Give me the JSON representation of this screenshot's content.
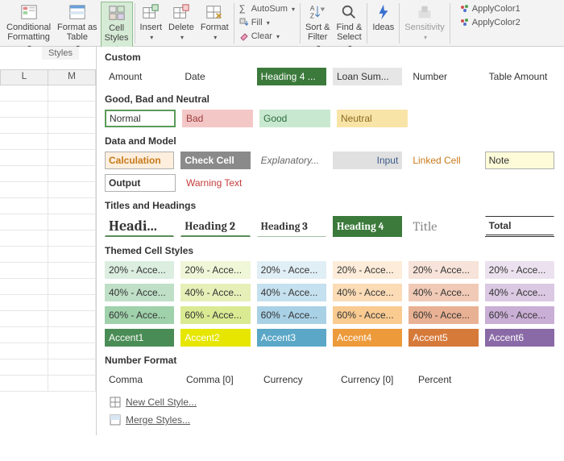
{
  "ribbon": {
    "cond_fmt": "Conditional\nFormatting",
    "fmt_table": "Format as\nTable",
    "cell_styles": "Cell\nStyles",
    "insert": "Insert",
    "delete": "Delete",
    "format": "Format",
    "autosum": "AutoSum",
    "fill": "Fill",
    "clear": "Clear",
    "sort_filter": "Sort &\nFilter",
    "find_select": "Find &\nSelect",
    "ideas": "Ideas",
    "sensitivity": "Sensitivity",
    "apply1": "ApplyColor1",
    "apply2": "ApplyColor2",
    "group_styles": "Styles"
  },
  "sheet": {
    "colL": "L",
    "colM": "M"
  },
  "sections": {
    "custom": "Custom",
    "gbn": "Good, Bad and Neutral",
    "dm": "Data and Model",
    "th": "Titles and Headings",
    "themed": "Themed Cell Styles",
    "nf": "Number Format"
  },
  "custom": {
    "amount": "Amount",
    "date": "Date",
    "h4": "Heading 4 ...",
    "loan": "Loan Sum...",
    "number": "Number",
    "tamount": "Table Amount"
  },
  "gbn": {
    "normal": "Normal",
    "bad": "Bad",
    "good": "Good",
    "neutral": "Neutral"
  },
  "dm": {
    "calc": "Calculation",
    "check": "Check Cell",
    "expl": "Explanatory...",
    "input": "Input",
    "linked": "Linked Cell",
    "note": "Note",
    "output": "Output",
    "warn": "Warning Text"
  },
  "th": {
    "h1": "Headi...",
    "h2": "Heading 2",
    "h3": "Heading 3",
    "h4": "Heading 4",
    "title": "Title",
    "total": "Total"
  },
  "themed_labels": {
    "p20": "20% - Acce...",
    "p40": "40% - Acce...",
    "p60": "60% - Acce...",
    "a1": "Accent1",
    "a2": "Accent2",
    "a3": "Accent3",
    "a4": "Accent4",
    "a5": "Accent5",
    "a6": "Accent6"
  },
  "themed_colors": {
    "r20": [
      "#dbeee0",
      "#f0f6d8",
      "#e0eef5",
      "#fdecd9",
      "#f7e3d9",
      "#ece2ef"
    ],
    "r40": [
      "#bfe0c7",
      "#e6efb7",
      "#c5e0ee",
      "#fbdcb6",
      "#f0cab6",
      "#dbc8e2"
    ],
    "r60": [
      "#9fd1ab",
      "#daea93",
      "#a9d1e6",
      "#f9cb91",
      "#e8b193",
      "#c9aed5"
    ],
    "acc": [
      "#4a8c55",
      "#e6e600",
      "#5aa7c7",
      "#ed9a3a",
      "#d67a3a",
      "#8a6aa6"
    ]
  },
  "nf": {
    "comma": "Comma",
    "comma0": "Comma [0]",
    "curr": "Currency",
    "curr0": "Currency [0]",
    "pct": "Percent"
  },
  "footer": {
    "newstyle": "New Cell Style...",
    "merge": "Merge Styles..."
  }
}
